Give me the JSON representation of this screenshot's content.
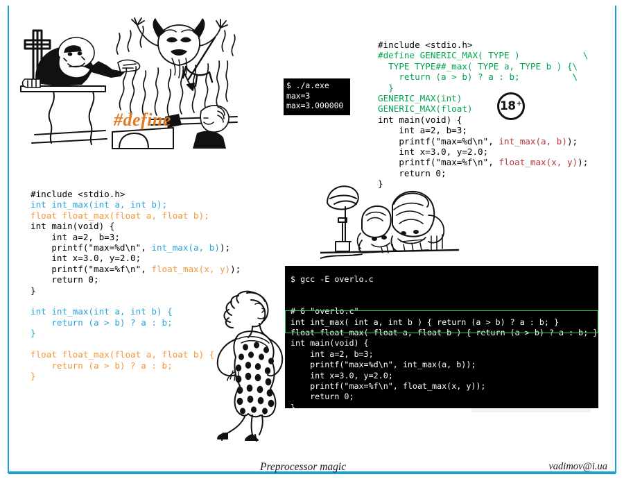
{
  "slide": {
    "frame_color": "#1b9dd9",
    "background": "#ffffff"
  },
  "artwork": {
    "preacher_devil": {
      "caption": "#define",
      "caption_color": "#e07a20",
      "alt": "cartoon of preacher at pulpit pointing at a horned devil amid flames"
    },
    "peeking_kids": {
      "alt": "cartoon of two figures peeking over an edge next to a lamp post and shovel"
    },
    "pinup_lady": {
      "alt": "line drawing of a woman in a polka-dot dress"
    },
    "badge": {
      "number": "18",
      "plus": "+"
    }
  },
  "code_top_right": {
    "lines": [
      [
        {
          "t": "#include <stdio.h>",
          "c": "black"
        }
      ],
      [
        {
          "t": "#define GENERIC_MAX( TYPE )            \\",
          "c": "green"
        }
      ],
      [
        {
          "t": "  TYPE TYPE##_max( TYPE a, TYPE b ) {\\",
          "c": "green"
        }
      ],
      [
        {
          "t": "    return (a > b) ? a : b;          \\",
          "c": "green"
        }
      ],
      [
        {
          "t": "  }",
          "c": "green"
        }
      ],
      [
        {
          "t": "GENERIC_MAX(int)",
          "c": "green"
        }
      ],
      [
        {
          "t": "GENERIC_MAX(float)",
          "c": "green"
        }
      ],
      [
        {
          "t": "int main(void) {",
          "c": "black"
        }
      ],
      [
        {
          "t": "    int a=2, b=3;",
          "c": "black"
        }
      ],
      [
        {
          "t": "    printf(\"max=%d\\n\", ",
          "c": "black"
        },
        {
          "t": "int_max(a, b)",
          "c": "red"
        },
        {
          "t": ");",
          "c": "black"
        }
      ],
      [
        {
          "t": "    int x=3.0, y=2.0;",
          "c": "black"
        }
      ],
      [
        {
          "t": "    printf(\"max=%f\\n\", ",
          "c": "black"
        },
        {
          "t": "float_max(x, y)",
          "c": "red"
        },
        {
          "t": ");",
          "c": "black"
        }
      ],
      [
        {
          "t": "    return 0;",
          "c": "black"
        }
      ],
      [
        {
          "t": "}",
          "c": "black"
        }
      ]
    ]
  },
  "code_bottom_left": {
    "lines": [
      [
        {
          "t": "#include <stdio.h>",
          "c": "black"
        }
      ],
      [
        {
          "t": "int int_max(int a, int b);",
          "c": "blue"
        }
      ],
      [
        {
          "t": "float float_max(float a, float b);",
          "c": "orange"
        }
      ],
      [
        {
          "t": "int main(void) {",
          "c": "black"
        }
      ],
      [
        {
          "t": "    int a=2, b=3;",
          "c": "black"
        }
      ],
      [
        {
          "t": "    printf(\"max=%d\\n\", ",
          "c": "black"
        },
        {
          "t": "int_max(a, b)",
          "c": "blue"
        },
        {
          "t": ");",
          "c": "black"
        }
      ],
      [
        {
          "t": "    int x=3.0, y=2.0;",
          "c": "black"
        }
      ],
      [
        {
          "t": "    printf(\"max=%f\\n\", ",
          "c": "black"
        },
        {
          "t": "float_max(x, y)",
          "c": "orange"
        },
        {
          "t": ");",
          "c": "black"
        }
      ],
      [
        {
          "t": "    return 0;",
          "c": "black"
        }
      ],
      [
        {
          "t": "}",
          "c": "black"
        }
      ],
      [
        {
          "t": "",
          "c": "black"
        }
      ],
      [
        {
          "t": "int int_max(int a, int b) {",
          "c": "blue"
        }
      ],
      [
        {
          "t": "    return (a > b) ? a : b;",
          "c": "blue"
        }
      ],
      [
        {
          "t": "}",
          "c": "blue"
        }
      ],
      [
        {
          "t": "",
          "c": "black"
        }
      ],
      [
        {
          "t": "float float_max(float a, float b) {",
          "c": "orange"
        }
      ],
      [
        {
          "t": "    return (a > b) ? a : b;",
          "c": "orange"
        }
      ],
      [
        {
          "t": "}",
          "c": "orange"
        }
      ]
    ]
  },
  "terminal_small": {
    "text": "$ ./a.exe\nmax=3\nmax=3.000000"
  },
  "terminal_big": {
    "text": "$ gcc -E overlo.c\n\n\n# 6 \"overlo.c\"\nint int_max( int a, int b ) { return (a > b) ? a : b; }\nfloat float_max( float a, float b ) { return (a > b) ? a : b; }\nint main(void) {\n    int a=2, b=3;\n    printf(\"max=%d\\n\", int_max(a, b));\n    int x=3.0, y=2.0;\n    printf(\"max=%f\\n\", float_max(x, y));\n    return 0;\n}",
    "highlight_color": "#2ecc4a"
  },
  "footer": {
    "title": "Preprocessor magic",
    "email": "vadimov@i.ua"
  }
}
